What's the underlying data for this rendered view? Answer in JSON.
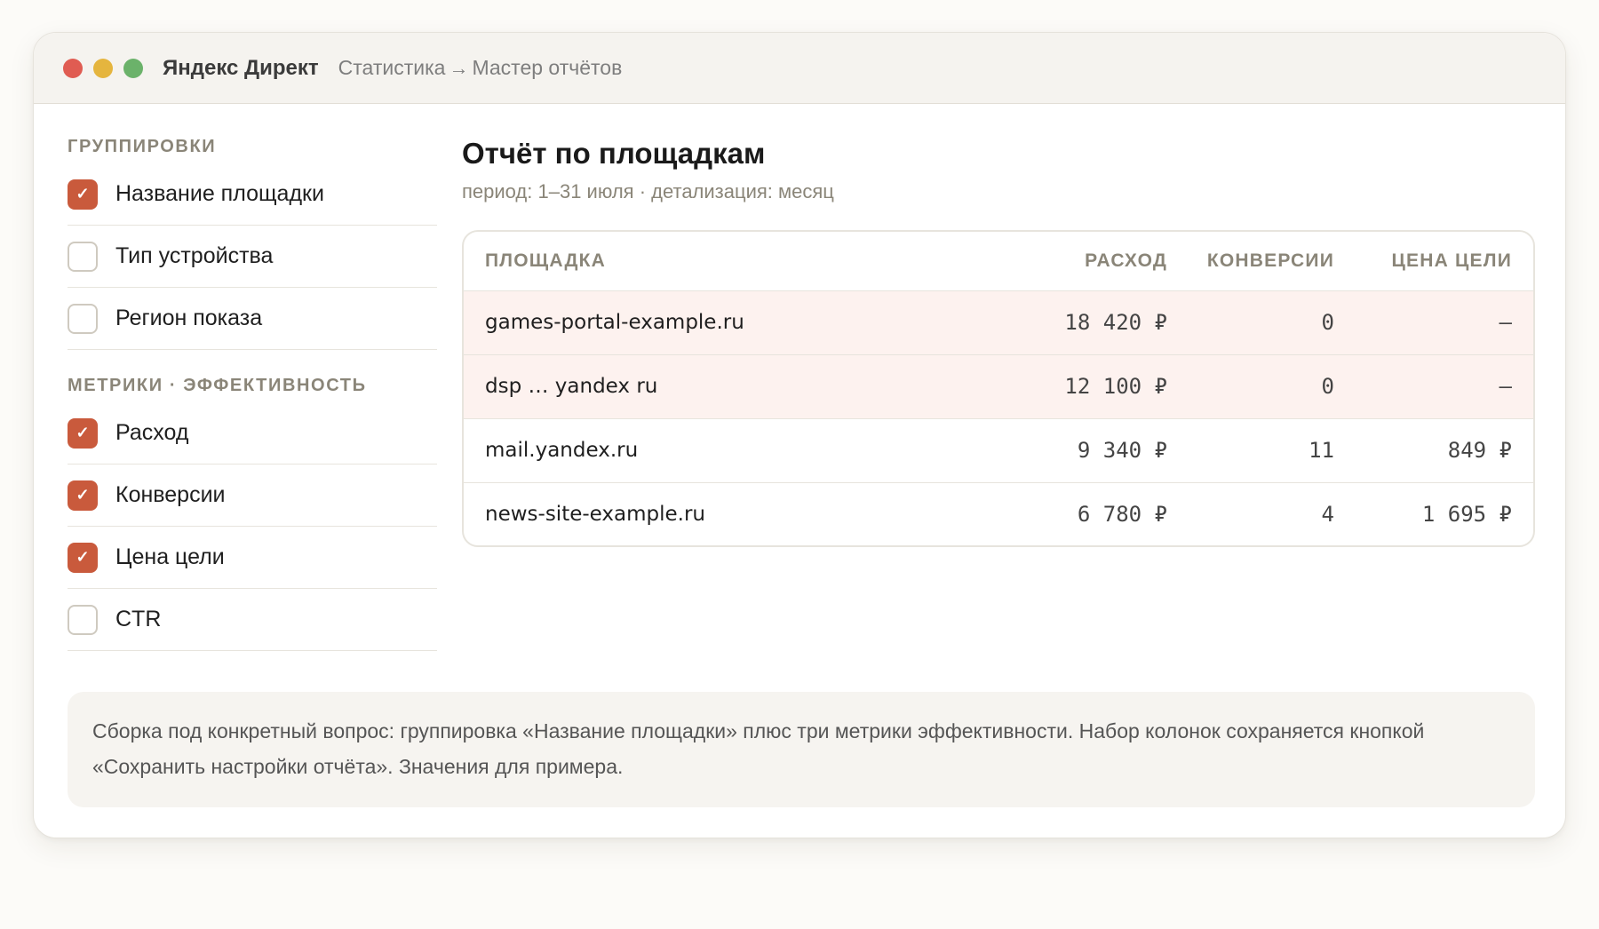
{
  "window": {
    "app_title": "Яндекс Директ",
    "breadcrumb": {
      "parent": "Статистика",
      "separator": "→",
      "current": "Мастер отчётов"
    }
  },
  "sidebar": {
    "groupings_title": "ГРУППИРОВКИ",
    "groupings": [
      {
        "label": "Название площадки",
        "checked": true
      },
      {
        "label": "Тип устройства",
        "checked": false
      },
      {
        "label": "Регион показа",
        "checked": false
      }
    ],
    "metrics_title": "МЕТРИКИ · ЭФФЕКТИВНОСТЬ",
    "metrics": [
      {
        "label": "Расход",
        "checked": true
      },
      {
        "label": "Конверсии",
        "checked": true
      },
      {
        "label": "Цена цели",
        "checked": true
      },
      {
        "label": "CTR",
        "checked": false
      }
    ]
  },
  "report": {
    "title": "Отчёт по площадкам",
    "subtitle": "период: 1–31 июля · детализация: месяц",
    "columns": {
      "site": "ПЛОЩАДКА",
      "cost": "РАСХОД",
      "conversions": "КОНВЕРСИИ",
      "goal_price": "ЦЕНА ЦЕЛИ"
    },
    "rows": [
      {
        "site": "games-portal-example.ru",
        "cost": "18 420 ₽",
        "conversions": "0",
        "goal_price": "—",
        "highlight": true
      },
      {
        "site": "dsp … yandex ru",
        "cost": "12 100 ₽",
        "conversions": "0",
        "goal_price": "—",
        "highlight": true
      },
      {
        "site": "mail.yandex.ru",
        "cost": "9 340 ₽",
        "conversions": "11",
        "goal_price": "849 ₽",
        "highlight": false
      },
      {
        "site": "news-site-example.ru",
        "cost": "6 780 ₽",
        "conversions": "4",
        "goal_price": "1 695 ₽",
        "highlight": false
      }
    ]
  },
  "note": "Сборка под конкретный вопрос: группировка «Название площадки» плюс три метрики эффективности. Набор колонок сохраняется кнопкой «Сохранить настройки отчёта». Значения для примера.",
  "colors": {
    "accent": "#c95a3c",
    "highlight_row": "#fdf2ef",
    "traffic_red": "#e05c52",
    "traffic_yellow": "#e5b53e",
    "traffic_green": "#6bb26a"
  }
}
